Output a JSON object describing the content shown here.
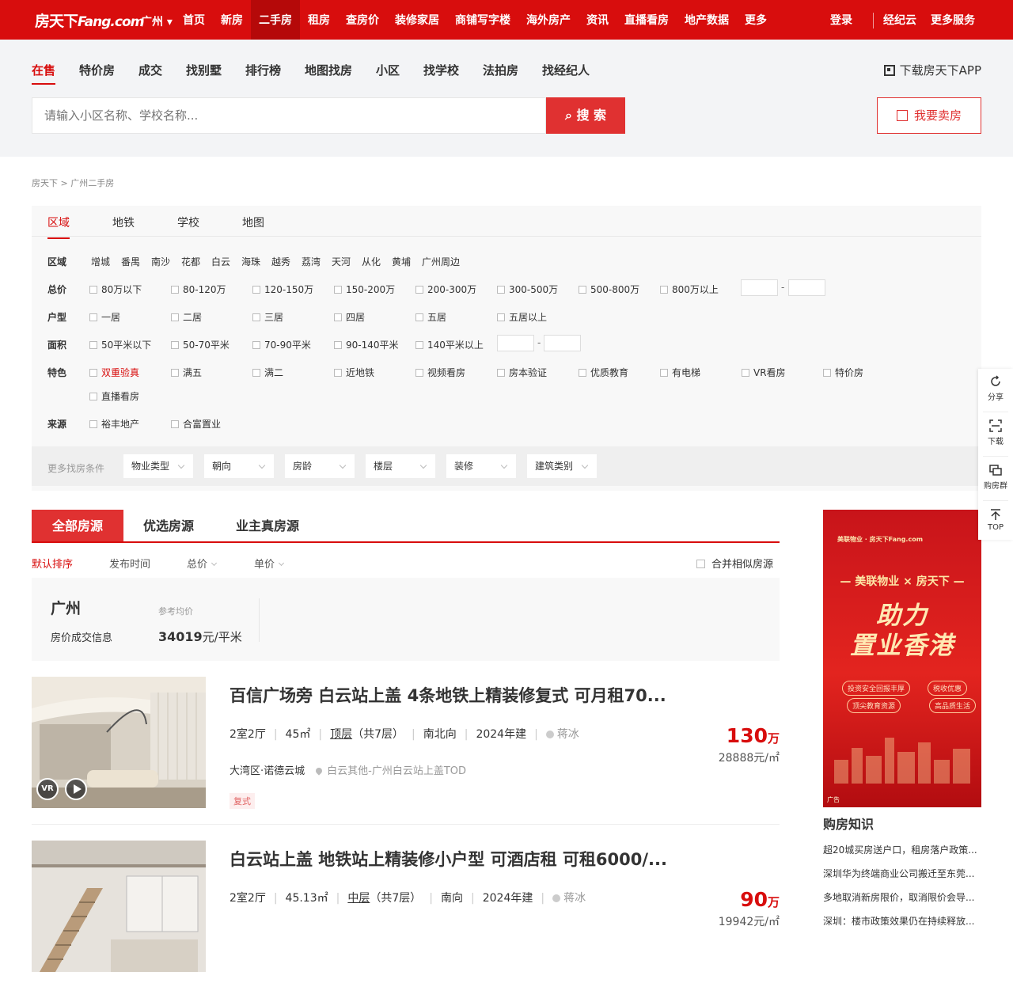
{
  "topnav": {
    "logo_cn": "房天下",
    "logo_en": "Fang.com",
    "city": "广州",
    "items": [
      "首页",
      "新房",
      "二手房",
      "租房",
      "查房价",
      "装修家居",
      "商铺写字楼",
      "海外房产",
      "资讯",
      "直播看房",
      "地产数据",
      "更多"
    ],
    "login": "登录",
    "broker": "经纪云",
    "more_services": "更多服务"
  },
  "subhead": {
    "tabs": [
      "在售",
      "特价房",
      "成交",
      "找别墅",
      "排行榜",
      "地图找房",
      "小区",
      "找学校",
      "法拍房",
      "找经纪人"
    ],
    "app_download": "下载房天下APP",
    "search_placeholder": "请输入小区名称、学校名称...",
    "search_button": "搜 索",
    "sell_button": "我要卖房"
  },
  "breadcrumb": "房天下 > 广州二手房",
  "filter": {
    "tabs": [
      "区域",
      "地铁",
      "学校",
      "地图"
    ],
    "region_label": "区域",
    "regions": [
      "增城",
      "番禺",
      "南沙",
      "花都",
      "白云",
      "海珠",
      "越秀",
      "荔湾",
      "天河",
      "从化",
      "黄埔",
      "广州周边"
    ],
    "price_label": "总价",
    "prices": [
      "80万以下",
      "80-120万",
      "120-150万",
      "150-200万",
      "200-300万",
      "300-500万",
      "500-800万",
      "800万以上"
    ],
    "layout_label": "户型",
    "layouts": [
      "一居",
      "二居",
      "三居",
      "四居",
      "五居",
      "五居以上"
    ],
    "area_label": "面积",
    "areas": [
      "50平米以下",
      "50-70平米",
      "70-90平米",
      "90-140平米",
      "140平米以上"
    ],
    "feature_label": "特色",
    "features": [
      "双重验真",
      "满五",
      "满二",
      "近地铁",
      "视频看房",
      "房本验证",
      "优质教育",
      "有电梯",
      "VR看房",
      "特价房",
      "直播看房"
    ],
    "source_label": "来源",
    "sources": [
      "裕丰地产",
      "合富置业"
    ],
    "more_label": "更多找房条件",
    "dropdowns": [
      "物业类型",
      "朝向",
      "房龄",
      "楼层",
      "装修",
      "建筑类别"
    ],
    "range_dash": "-"
  },
  "listing_tabs": [
    "全部房源",
    "优选房源",
    "业主真房源"
  ],
  "sort": {
    "options": [
      "默认排序",
      "发布时间",
      "总价",
      "单价"
    ],
    "merge": "合并相似房源"
  },
  "pricebox": {
    "city": "广州",
    "info": "房价成交信息",
    "ref_label": "参考均价",
    "avg_price": "34019",
    "avg_unit": "元/平米"
  },
  "listings": [
    {
      "title": "百信广场旁 白云站上盖 4条地铁上精装修复式 可月租70...",
      "layout": "2室2厅",
      "area": "45㎡",
      "floor": "顶层",
      "floor_total": "（共7层）",
      "orientation": "南北向",
      "built": "2024年建",
      "agent": "蒋冰",
      "community": "大湾区·诺德云城",
      "address": "白云其他-广州白云站上盖TOD",
      "tag": "复式",
      "price": "130",
      "price_unit": "万",
      "unit_price": "28888元/㎡",
      "vr": "VR"
    },
    {
      "title": "白云站上盖 地铁站上精装修小户型 可酒店租 可租6000/...",
      "layout": "2室2厅",
      "area": "45.13㎡",
      "floor": "中层",
      "floor_total": "（共7层）",
      "orientation": "南向",
      "built": "2024年建",
      "agent": "蒋冰",
      "price": "90",
      "price_unit": "万",
      "unit_price": "19942元/㎡"
    }
  ],
  "ad": {
    "logo": "美联物业 · 房天下Fang.com",
    "line1": "— 美联物业 × 房天下 —",
    "big1": "助力",
    "big2": "置业香港",
    "pills": [
      "投资安全回报丰厚",
      "税收优惠",
      "顶尖教育资源",
      "高品质生活"
    ],
    "tag": "广告"
  },
  "knowledge": {
    "title": "购房知识",
    "items": [
      "超20城买房送户口，租房落户政策...",
      "深圳华为终端商业公司搬迁至东莞...",
      "多地取消新房限价，取消限价会导...",
      "深圳：楼市政策效果仍在持续释放..."
    ]
  },
  "sidefloat": [
    "分享",
    "下载",
    "购房群",
    "TOP"
  ],
  "colors": {
    "brand_red": "#d80d0d",
    "price_red": "#d80d0d"
  }
}
